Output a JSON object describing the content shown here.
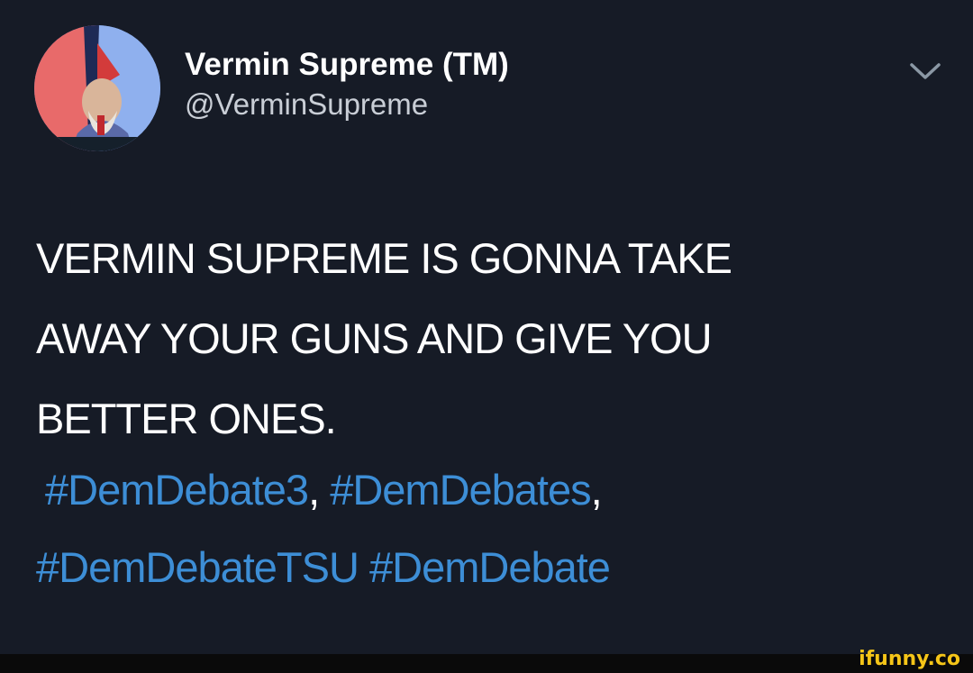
{
  "author": {
    "display_name": "Vermin Supreme (TM)",
    "handle": "@VerminSupreme"
  },
  "tweet": {
    "text_lines": [
      "VERMIN SUPREME IS GONNA TAKE",
      "AWAY YOUR GUNS AND GIVE YOU",
      "BETTER ONES."
    ],
    "hashtags": [
      "#DemDebate3",
      "#DemDebates",
      "#DemDebateTSU",
      "#DemDebate"
    ],
    "separators": [
      ",",
      ","
    ]
  },
  "icons": {
    "menu": "chevron-down-icon"
  },
  "colors": {
    "background": "#161b26",
    "hashtag": "#3d8ed6",
    "watermark": "#f5c518"
  },
  "watermark": "ifunny.co"
}
